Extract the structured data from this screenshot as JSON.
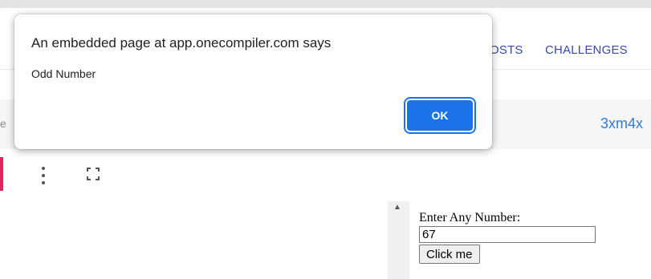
{
  "nav": {
    "posts_label": "OSTS",
    "challenges_label": "CHALLENGES"
  },
  "editor": {
    "edge_letter": "e",
    "code_id": "3xm4x"
  },
  "toolbar": {
    "menu_icon": "kebab-menu-icon",
    "fullscreen_icon": "fullscreen-icon",
    "accent_color": "#e0245e"
  },
  "output": {
    "prompt": "Enter Any Number:",
    "input_value": "67",
    "button_label": "Click me"
  },
  "dialog": {
    "title": "An embedded page at app.onecompiler.com says",
    "message": "Odd Number",
    "ok_label": "OK",
    "ok_color": "#1a73e8"
  },
  "colors": {
    "nav_link": "#3b4aa8",
    "code_id": "#2e7bd6"
  }
}
